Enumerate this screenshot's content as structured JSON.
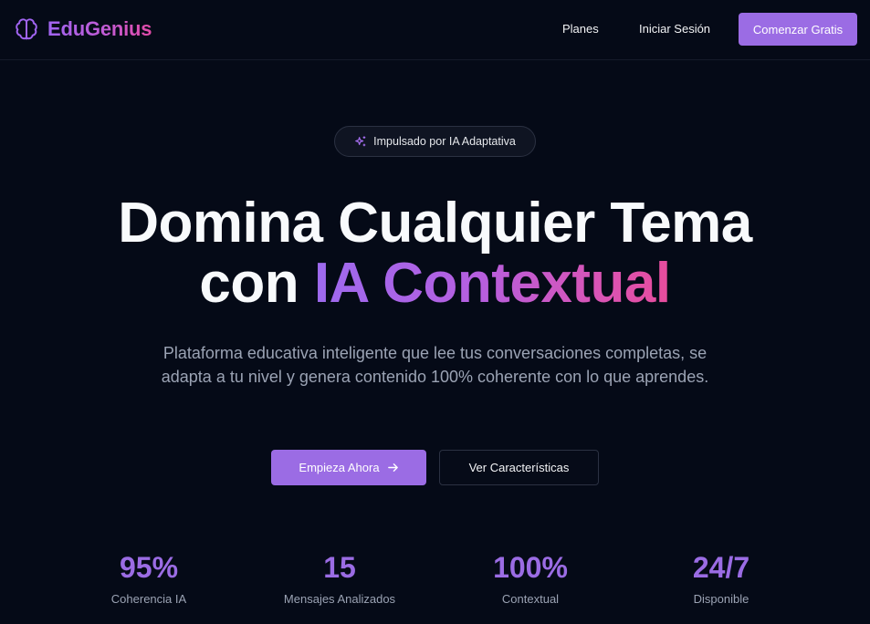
{
  "header": {
    "brand": "EduGenius",
    "brand_icon": "brain-icon",
    "nav": {
      "plans": "Planes",
      "login": "Iniciar Sesión",
      "cta": "Comenzar Gratis"
    }
  },
  "hero": {
    "badge": {
      "icon": "sparkles-icon",
      "text": "Impulsado por IA Adaptativa"
    },
    "headline_line1": "Domina Cualquier Tema",
    "headline_line2_prefix": "con ",
    "headline_line2_highlight": "IA Contextual",
    "subtitle": "Plataforma educativa inteligente que lee tus conversaciones completas, se adapta a tu nivel y genera contenido 100% coherente con lo que aprendes.",
    "primary_cta": "Empieza Ahora",
    "primary_cta_icon": "arrow-right-icon",
    "secondary_cta": "Ver Características"
  },
  "stats": [
    {
      "value": "95%",
      "label": "Coherencia IA"
    },
    {
      "value": "15",
      "label": "Mensajes Analizados"
    },
    {
      "value": "100%",
      "label": "Contextual"
    },
    {
      "value": "24/7",
      "label": "Disponible"
    }
  ],
  "colors": {
    "background": "#050a17",
    "accent": "#9b6ce4",
    "gradient_start": "#9d6aee",
    "gradient_end": "#e84c9c",
    "muted_text": "#9ba3b4"
  }
}
